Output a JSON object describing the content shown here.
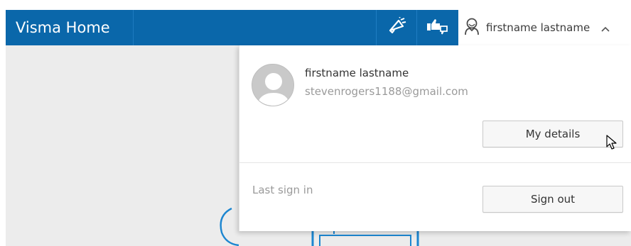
{
  "app": {
    "title": "Visma Home"
  },
  "header": {
    "user_name": "firstname lastname",
    "icons": [
      "megaphone-icon",
      "thumbs-feedback-icon",
      "user-icon",
      "chevron-up-icon"
    ]
  },
  "dropdown": {
    "profile_name": "firstname lastname",
    "profile_email": "stevenrogers1188@gmail.com",
    "my_details_label": "My details",
    "last_sign_in_label": "Last sign in",
    "sign_out_label": "Sign out"
  },
  "colors": {
    "brand_blue": "#0a67aa",
    "background_gray": "#ececec"
  }
}
